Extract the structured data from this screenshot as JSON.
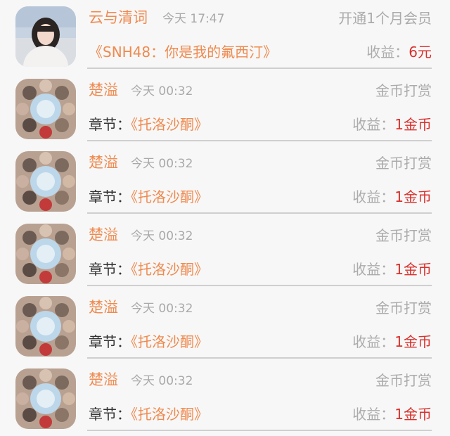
{
  "records": [
    {
      "avatar": "user-photo-avatar",
      "name": "云与清词",
      "time": "今天 17:47",
      "kind": "开通1个月会员",
      "detail_label": "",
      "detail_title": "《SNH48：你是我的氟西汀》",
      "income_label": "收益：",
      "income_value": "6元"
    },
    {
      "avatar": "group-photo-avatar",
      "name": "楚溢",
      "time": "今天 00:32",
      "kind": "金币打赏",
      "detail_label": "章节：",
      "detail_title": "《托洛沙酮》",
      "income_label": "收益：",
      "income_value": "1金币"
    },
    {
      "avatar": "group-photo-avatar",
      "name": "楚溢",
      "time": "今天 00:32",
      "kind": "金币打赏",
      "detail_label": "章节：",
      "detail_title": "《托洛沙酮》",
      "income_label": "收益：",
      "income_value": "1金币"
    },
    {
      "avatar": "group-photo-avatar",
      "name": "楚溢",
      "time": "今天 00:32",
      "kind": "金币打赏",
      "detail_label": "章节：",
      "detail_title": "《托洛沙酮》",
      "income_label": "收益：",
      "income_value": "1金币"
    },
    {
      "avatar": "group-photo-avatar",
      "name": "楚溢",
      "time": "今天 00:32",
      "kind": "金币打赏",
      "detail_label": "章节：",
      "detail_title": "《托洛沙酮》",
      "income_label": "收益：",
      "income_value": "1金币"
    },
    {
      "avatar": "group-photo-avatar",
      "name": "楚溢",
      "time": "今天 00:32",
      "kind": "金币打赏",
      "detail_label": "章节：",
      "detail_title": "《托洛沙酮》",
      "income_label": "收益：",
      "income_value": "1金币"
    }
  ],
  "colors": {
    "accent": "#ef8a4f",
    "income_value": "#d9302c",
    "muted": "#ababab"
  }
}
